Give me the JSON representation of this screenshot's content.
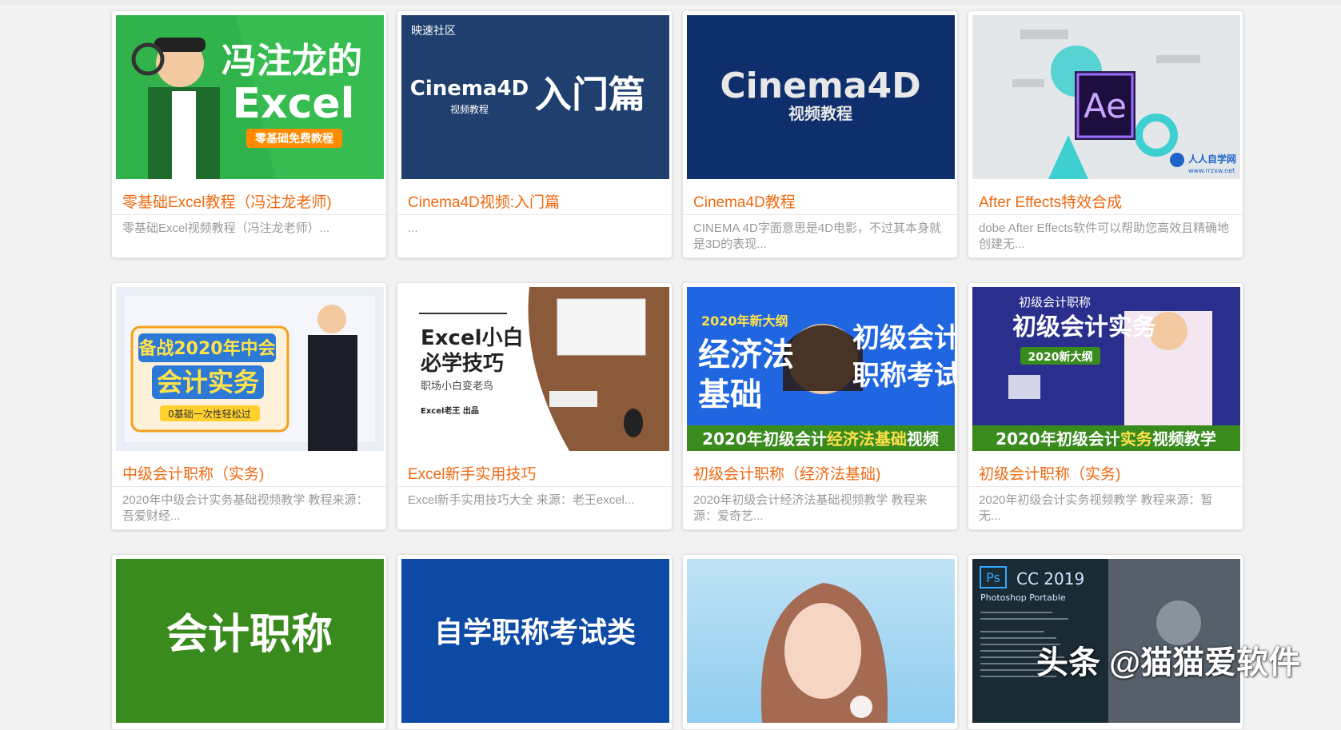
{
  "cards": [
    {
      "title": "零基础Excel教程（冯注龙老师)",
      "desc": "零基础Excel视频教程（冯注龙老师）...",
      "thumb": {
        "line1": "冯注龙的",
        "line2": "Excel",
        "badge": "零基础免费教程"
      }
    },
    {
      "title": "Cinema4D视频:入门篇",
      "desc": "...",
      "thumb": {
        "tag": "映速社区",
        "brand": "Cinema4D",
        "sub": "视频教程",
        "big": "入门篇"
      }
    },
    {
      "title": "Cinema4D教程",
      "desc": "CINEMA 4D字面意思是4D电影，不过其本身就是3D的表现...",
      "thumb": {
        "brand": "Cinema4D",
        "sub": "视频教程"
      }
    },
    {
      "title": "After Effects特效合成",
      "desc": "dobe After Effects软件可以帮助您高效且精确地创建无...",
      "thumb": {
        "logo": "Ae",
        "site": "人人自学网",
        "url": "www.rrzxw.net"
      }
    },
    {
      "title": "中级会计职称（实务)",
      "desc": "2020年中级会计实务基础视频教学 教程来源：吾爱财经...",
      "thumb": {
        "line1": "备战2020年中会",
        "line2": "会计实务",
        "badge": "0基础一次性轻松过"
      }
    },
    {
      "title": "Excel新手实用技巧",
      "desc": "Excel新手实用技巧大全 来源：老王excel...",
      "thumb": {
        "line1": "Excel小白",
        "line2": "必学技巧",
        "sub": "职场小白变老鸟",
        "credit": "Excel老王 出品"
      }
    },
    {
      "title": "初级会计职称（经济法基础)",
      "desc": "2020年初级会计经济法基础视频教学 教程来源：爱奇艺...",
      "thumb": {
        "year": "2020年新大纲",
        "left": "经济法\n基础",
        "right1": "初级会计",
        "right2": "职称考试",
        "bar_pre": "2020年初级会计",
        "bar_hi": "经济法基础",
        "bar_post": "视频"
      }
    },
    {
      "title": "初级会计职称（实务)",
      "desc": "2020年初级会计实务视频教学 教程来源：暂无...",
      "thumb": {
        "small": "初级会计职称",
        "big": "初级会计实务",
        "badge": "2020新大纲",
        "bar_pre": "2020年初级会计",
        "bar_hi": "实务",
        "bar_post": "视频教学"
      }
    },
    {
      "thumb": {
        "text": "会计职称"
      }
    },
    {
      "thumb": {
        "text": "自学职称考试类"
      }
    },
    {
      "thumb": {}
    },
    {
      "thumb": {
        "ps": "Ps",
        "ver": "CC 2019",
        "name": "Photoshop Portable"
      }
    }
  ],
  "watermark": "头条 @猫猫爱软件",
  "colors": {
    "title": "#ee6a12",
    "desc": "#9a9a9a",
    "accent_green": "#3a8b1e",
    "accent_blue": "#0d4aa6"
  }
}
